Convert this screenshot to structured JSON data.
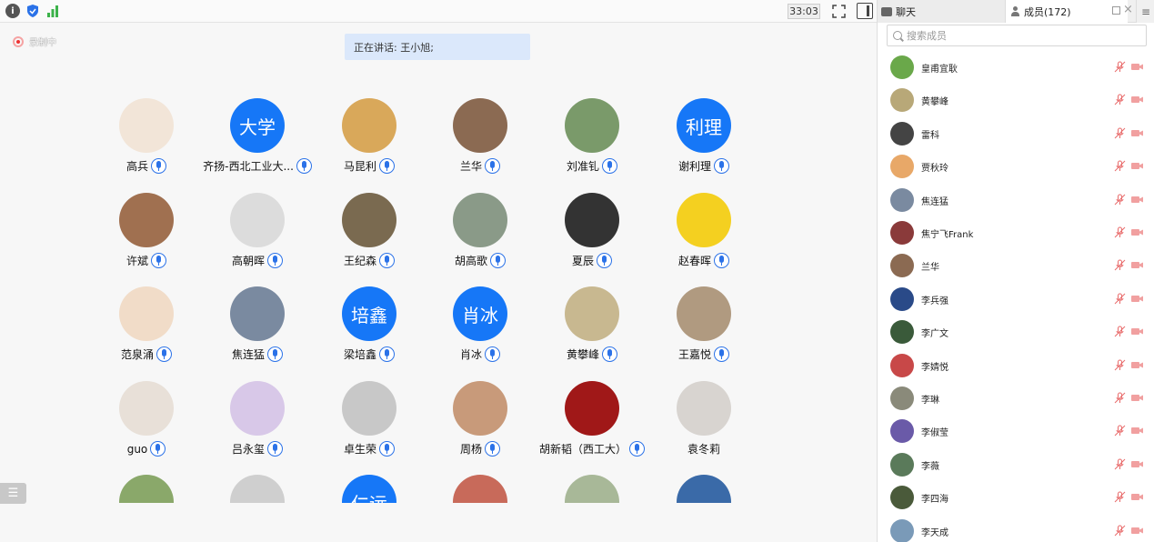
{
  "topbar": {
    "timer": "33:03",
    "icons": [
      "info-icon",
      "shield-icon",
      "signal-icon",
      "fullscreen-icon",
      "side-panel-icon"
    ]
  },
  "recording": {
    "label": "录制中"
  },
  "speaking": {
    "text": "正在讲话: 王小旭;"
  },
  "list_button": {
    "icon": "list-icon"
  },
  "colors": {
    "accent": "#1677f7",
    "highlight": "#dbe8fb",
    "mic_off": "#e86a6a"
  },
  "grid": {
    "tiles": [
      {
        "name": "高兵",
        "avatar_text": "",
        "bg": "#f2e5d8",
        "mic": true
      },
      {
        "name": "齐扬-西北工业大...",
        "avatar_text": "大学",
        "bg": "#1677f7",
        "mic": true
      },
      {
        "name": "马昆利",
        "avatar_text": "",
        "bg": "#d9a85a",
        "mic": true
      },
      {
        "name": "兰华",
        "avatar_text": "",
        "bg": "#8b6a52",
        "mic": true
      },
      {
        "name": "刘准钆",
        "avatar_text": "",
        "bg": "#7a9a6a",
        "mic": true
      },
      {
        "name": "谢利理",
        "avatar_text": "利理",
        "bg": "#1677f7",
        "mic": true
      },
      {
        "name": "许斌",
        "avatar_text": "",
        "bg": "#a07050",
        "mic": true
      },
      {
        "name": "高朝晖",
        "avatar_text": "",
        "bg": "#dcdcdc",
        "mic": true
      },
      {
        "name": "王纪森",
        "avatar_text": "",
        "bg": "#7a6a50",
        "mic": true
      },
      {
        "name": "胡高歌",
        "avatar_text": "",
        "bg": "#8a9a88",
        "mic": true
      },
      {
        "name": "夏辰",
        "avatar_text": "",
        "bg": "#333333",
        "mic": true
      },
      {
        "name": "赵春晖",
        "avatar_text": "",
        "bg": "#f4d020",
        "mic": true
      },
      {
        "name": "范泉涌",
        "avatar_text": "",
        "bg": "#f1dcc8",
        "mic": true
      },
      {
        "name": "焦连猛",
        "avatar_text": "",
        "bg": "#7a8aa0",
        "mic": true
      },
      {
        "name": "梁培鑫",
        "avatar_text": "培鑫",
        "bg": "#1677f7",
        "mic": true
      },
      {
        "name": "肖冰",
        "avatar_text": "肖冰",
        "bg": "#1677f7",
        "mic": true
      },
      {
        "name": "黄攀峰",
        "avatar_text": "",
        "bg": "#c8b890",
        "mic": true
      },
      {
        "name": "王嘉悦",
        "avatar_text": "",
        "bg": "#b09a80",
        "mic": true
      },
      {
        "name": "guo",
        "avatar_text": "",
        "bg": "#e8e0d8",
        "mic": true
      },
      {
        "name": "吕永玺",
        "avatar_text": "",
        "bg": "#d8c8e8",
        "mic": true
      },
      {
        "name": "卓生荣",
        "avatar_text": "",
        "bg": "#c8c8c8",
        "mic": true
      },
      {
        "name": "周杨",
        "avatar_text": "",
        "bg": "#c89a7a",
        "mic": true
      },
      {
        "name": "胡新韬（西工大）",
        "avatar_text": "",
        "bg": "#a01818",
        "mic": true
      },
      {
        "name": "袁冬莉",
        "avatar_text": "",
        "bg": "#d8d4d0",
        "mic": false
      },
      {
        "name": "",
        "avatar_text": "",
        "bg": "#8aa86a",
        "mic": false
      },
      {
        "name": "",
        "avatar_text": "",
        "bg": "#cfcfcf",
        "mic": false
      },
      {
        "name": "",
        "avatar_text": "仁远",
        "bg": "#1677f7",
        "mic": false
      },
      {
        "name": "",
        "avatar_text": "",
        "bg": "#c86a5a",
        "mic": false
      },
      {
        "name": "",
        "avatar_text": "",
        "bg": "#a8b898",
        "mic": false
      },
      {
        "name": "",
        "avatar_text": "",
        "bg": "#3a6aa8",
        "mic": false
      }
    ]
  },
  "side": {
    "tab_chat": "聊天",
    "tab_members": "成员(172)",
    "search_placeholder": "搜索成员",
    "members": [
      {
        "name": "皇甫宜耿",
        "bg": "#6aa84a"
      },
      {
        "name": "黄攀峰",
        "bg": "#b8a878"
      },
      {
        "name": "雷科",
        "bg": "#444444"
      },
      {
        "name": "贾秋玲",
        "bg": "#e8a868"
      },
      {
        "name": "焦连猛",
        "bg": "#7a8aa0"
      },
      {
        "name": "焦宁飞Frank",
        "bg": "#8a3a3a"
      },
      {
        "name": "兰华",
        "bg": "#8b6a52"
      },
      {
        "name": "李兵强",
        "bg": "#2a4a88"
      },
      {
        "name": "李广文",
        "bg": "#3a5a3a"
      },
      {
        "name": "李婧悦",
        "bg": "#c84848"
      },
      {
        "name": "李琳",
        "bg": "#8a8a7a"
      },
      {
        "name": "李俶莹",
        "bg": "#6a5aa8"
      },
      {
        "name": "李薇",
        "bg": "#5a7a5a"
      },
      {
        "name": "李四海",
        "bg": "#4a5a3a"
      },
      {
        "name": "李天成",
        "bg": "#7a9ab8"
      }
    ]
  }
}
